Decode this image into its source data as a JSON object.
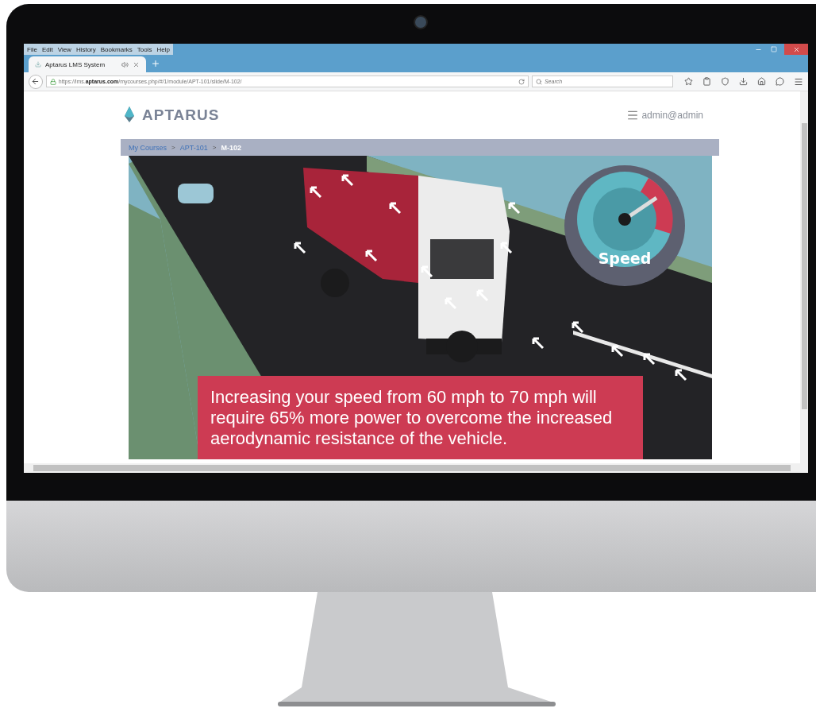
{
  "browser": {
    "menu": [
      "File",
      "Edit",
      "View",
      "History",
      "Bookmarks",
      "Tools",
      "Help"
    ],
    "tabs": [
      {
        "title": "Aptarus LMS System",
        "selected": true
      }
    ],
    "url": "https://lms.**aptarus.com**/mycourses.php/#/1/module/APT-101/slide/M-102/",
    "search": {
      "placeholder": "Search"
    }
  },
  "site": {
    "logo": "APTARUS",
    "user": "admin@admin"
  },
  "breadcrumb": {
    "items": [
      {
        "label": "My Courses",
        "current": false
      },
      {
        "label": "APT-101",
        "current": false
      },
      {
        "label": "M-102",
        "current": true
      }
    ],
    "separators": [
      ">",
      ">"
    ]
  },
  "slide": {
    "gauge_label": "Speed",
    "caption": "Increasing your speed from 60 mph to 70 mph will require 65% more power to overcome the increased aerodynamic resistance of the vehicle."
  }
}
